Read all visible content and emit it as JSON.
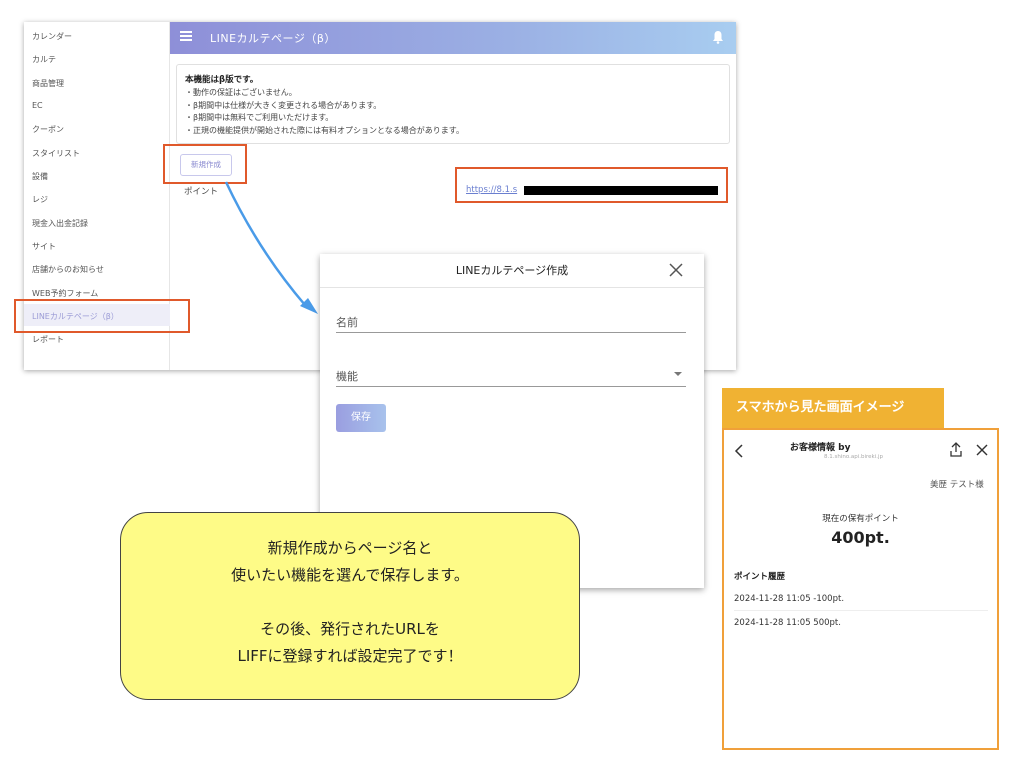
{
  "sidebar": {
    "items": [
      {
        "label": "カレンダー"
      },
      {
        "label": "カルテ"
      },
      {
        "label": "商品管理"
      },
      {
        "label": "EC"
      },
      {
        "label": "クーポン"
      },
      {
        "label": "スタイリスト"
      },
      {
        "label": "設備"
      },
      {
        "label": "レジ"
      },
      {
        "label": "現金入出金記録"
      },
      {
        "label": "サイト"
      },
      {
        "label": "店舗からのお知らせ"
      },
      {
        "label": "WEB予約フォーム"
      },
      {
        "label": "LINEカルテページ（β）",
        "active": true
      },
      {
        "label": "レポート"
      }
    ]
  },
  "header": {
    "title": "LINEカルテページ（β）",
    "menu_icon": "menu-icon",
    "bell_icon": "bell-icon"
  },
  "notice": {
    "title": "本機能はβ版です。",
    "lines": [
      "・動作の保証はございません。",
      "・β期間中は仕様が大きく変更される場合があります。",
      "・β期間中は無料でご利用いただけます。",
      "・正規の機能提供が開始された際には有料オプションとなる場合があります。"
    ]
  },
  "main": {
    "new_button": "新規作成",
    "point_label": "ポイント",
    "url_text": "https://8.1.s"
  },
  "modal": {
    "title": "LINEカルテページ作成",
    "name_label": "名前",
    "function_label": "機能",
    "save_button": "保存"
  },
  "callout": {
    "lines": [
      "新規作成からページ名と",
      "使いたい機能を選んで保存します。",
      "",
      "その後、発行されたURLを",
      "LIFFに登録すれば設定完了です！"
    ]
  },
  "phone": {
    "tab_label": "スマホから見た画面イメージ",
    "title": "お客様情報 by",
    "subtitle": "8.1.shino.api.bireki.jp",
    "user": "美歴 テスト様",
    "current_points_label": "現在の保有ポイント",
    "current_points": "400pt.",
    "history_title": "ポイント履歴",
    "history": [
      "2024-11-28 11:05 -100pt.",
      "2024-11-28 11:05 500pt."
    ]
  },
  "colors": {
    "accent": "#8e8fd8",
    "highlight": "#e0592b",
    "callout": "#fefb87",
    "phone_tab": "#f0b233",
    "arrow": "#4a9be8"
  }
}
